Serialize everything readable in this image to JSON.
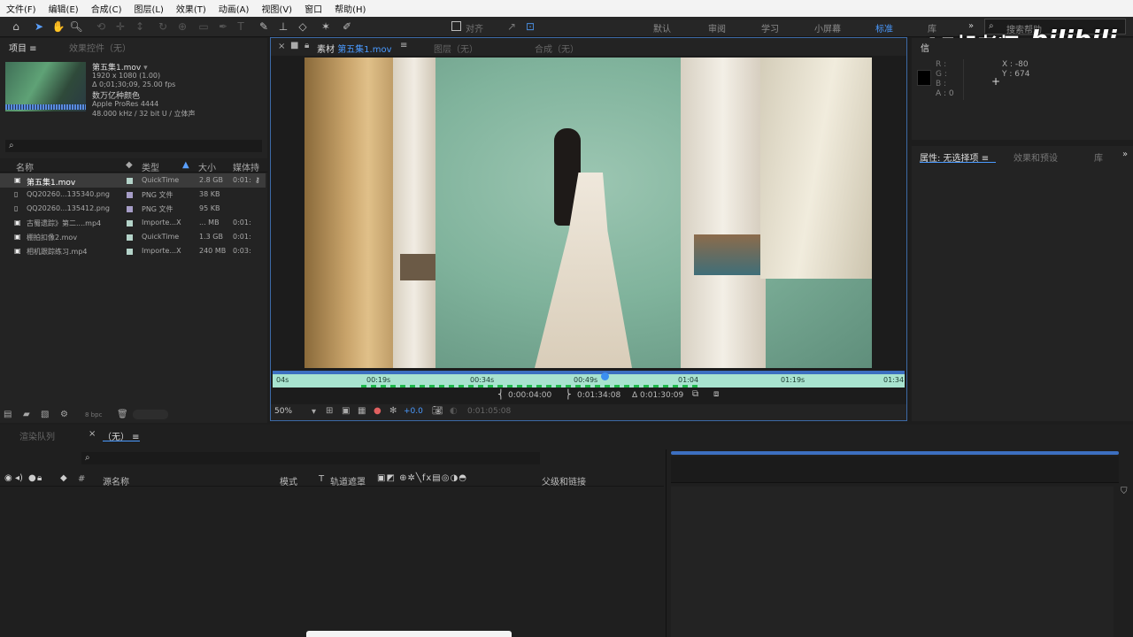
{
  "menu": [
    "文件(F)",
    "编辑(E)",
    "合成(C)",
    "图层(L)",
    "效果(T)",
    "动画(A)",
    "视图(V)",
    "窗口",
    "帮助(H)"
  ],
  "toolbar": {
    "align_label": "对齐",
    "workspaces": [
      "默认",
      "审阅",
      "学习",
      "小屏幕",
      "标准",
      "库"
    ],
    "search_placeholder": "搜索帮助"
  },
  "watermark": {
    "text": "AE胡老师",
    "logo": "bilibili"
  },
  "project": {
    "tab_label": "项目",
    "effects_tab": "效果控件（无）",
    "thumb": {
      "name": "第五集1.mov",
      "dims": "1920 x 1080 (1.00)",
      "duration": "Δ 0;01;30;09, 25.00 fps",
      "color": "数万亿种颜色",
      "codec": "Apple ProRes 4444",
      "audio": "48.000 kHz / 32 bit U / 立体声"
    },
    "search_placeholder": "",
    "columns": {
      "name": "名称",
      "type": "类型",
      "size": "大小",
      "dur": "媒体持续"
    },
    "rows": [
      {
        "name": "第五集1.mov",
        "type": "QuickTime",
        "size": "2.8 GB",
        "dur": "0:01:"
      },
      {
        "name": "QQ20260...135340.png",
        "type": "PNG 文件",
        "size": "38 KB",
        "dur": ""
      },
      {
        "name": "QQ20260...135412.png",
        "type": "PNG 文件",
        "size": "95 KB",
        "dur": ""
      },
      {
        "name": "古蜀遗踪》第二....mp4",
        "type": "Importe...X",
        "size": "... MB",
        "dur": "0:01:"
      },
      {
        "name": "棚拍扣像2.mov",
        "type": "QuickTime",
        "size": "1.3 GB",
        "dur": "0:01:"
      },
      {
        "name": "相机跟踪练习.mp4",
        "type": "Importe...X",
        "size": "240 MB",
        "dur": "0:03:"
      }
    ],
    "bpc": "8 bpc"
  },
  "viewer": {
    "tabs": {
      "footage_prefix": "素材",
      "footage_name": "第五集1.mov",
      "layer": "图层（无）",
      "comp": "合成（无）"
    },
    "ruler": [
      "04s",
      "00:19s",
      "00:34s",
      "00:49s",
      "01:04",
      "01:19s",
      "01:34"
    ],
    "in_time": "0:00:04:00",
    "out_time": "0:01:34:08",
    "dur_time": "Δ 0:01:30:09",
    "zoom": "50%",
    "exposure": "+0.0",
    "current_time": "0:01:05:08",
    "playhead_fraction": 0.52
  },
  "info": {
    "tab_short": "信",
    "r": "R :",
    "g": "G :",
    "b": "B :",
    "a": "A : 0",
    "x": "X : -80",
    "y": "Y : 674"
  },
  "props": {
    "tab": "属性: 无选择项",
    "effects_tab": "效果和预设",
    "lib_tab": "库"
  },
  "timeline": {
    "render_tab": "渲染队列",
    "comp_tab": "（无）",
    "search_placeholder": "",
    "cols": {
      "hash": "#",
      "source": "源名称",
      "mode": "模式",
      "t": "T",
      "track": "轨道遮罩",
      "parent": "父级和链接"
    }
  }
}
